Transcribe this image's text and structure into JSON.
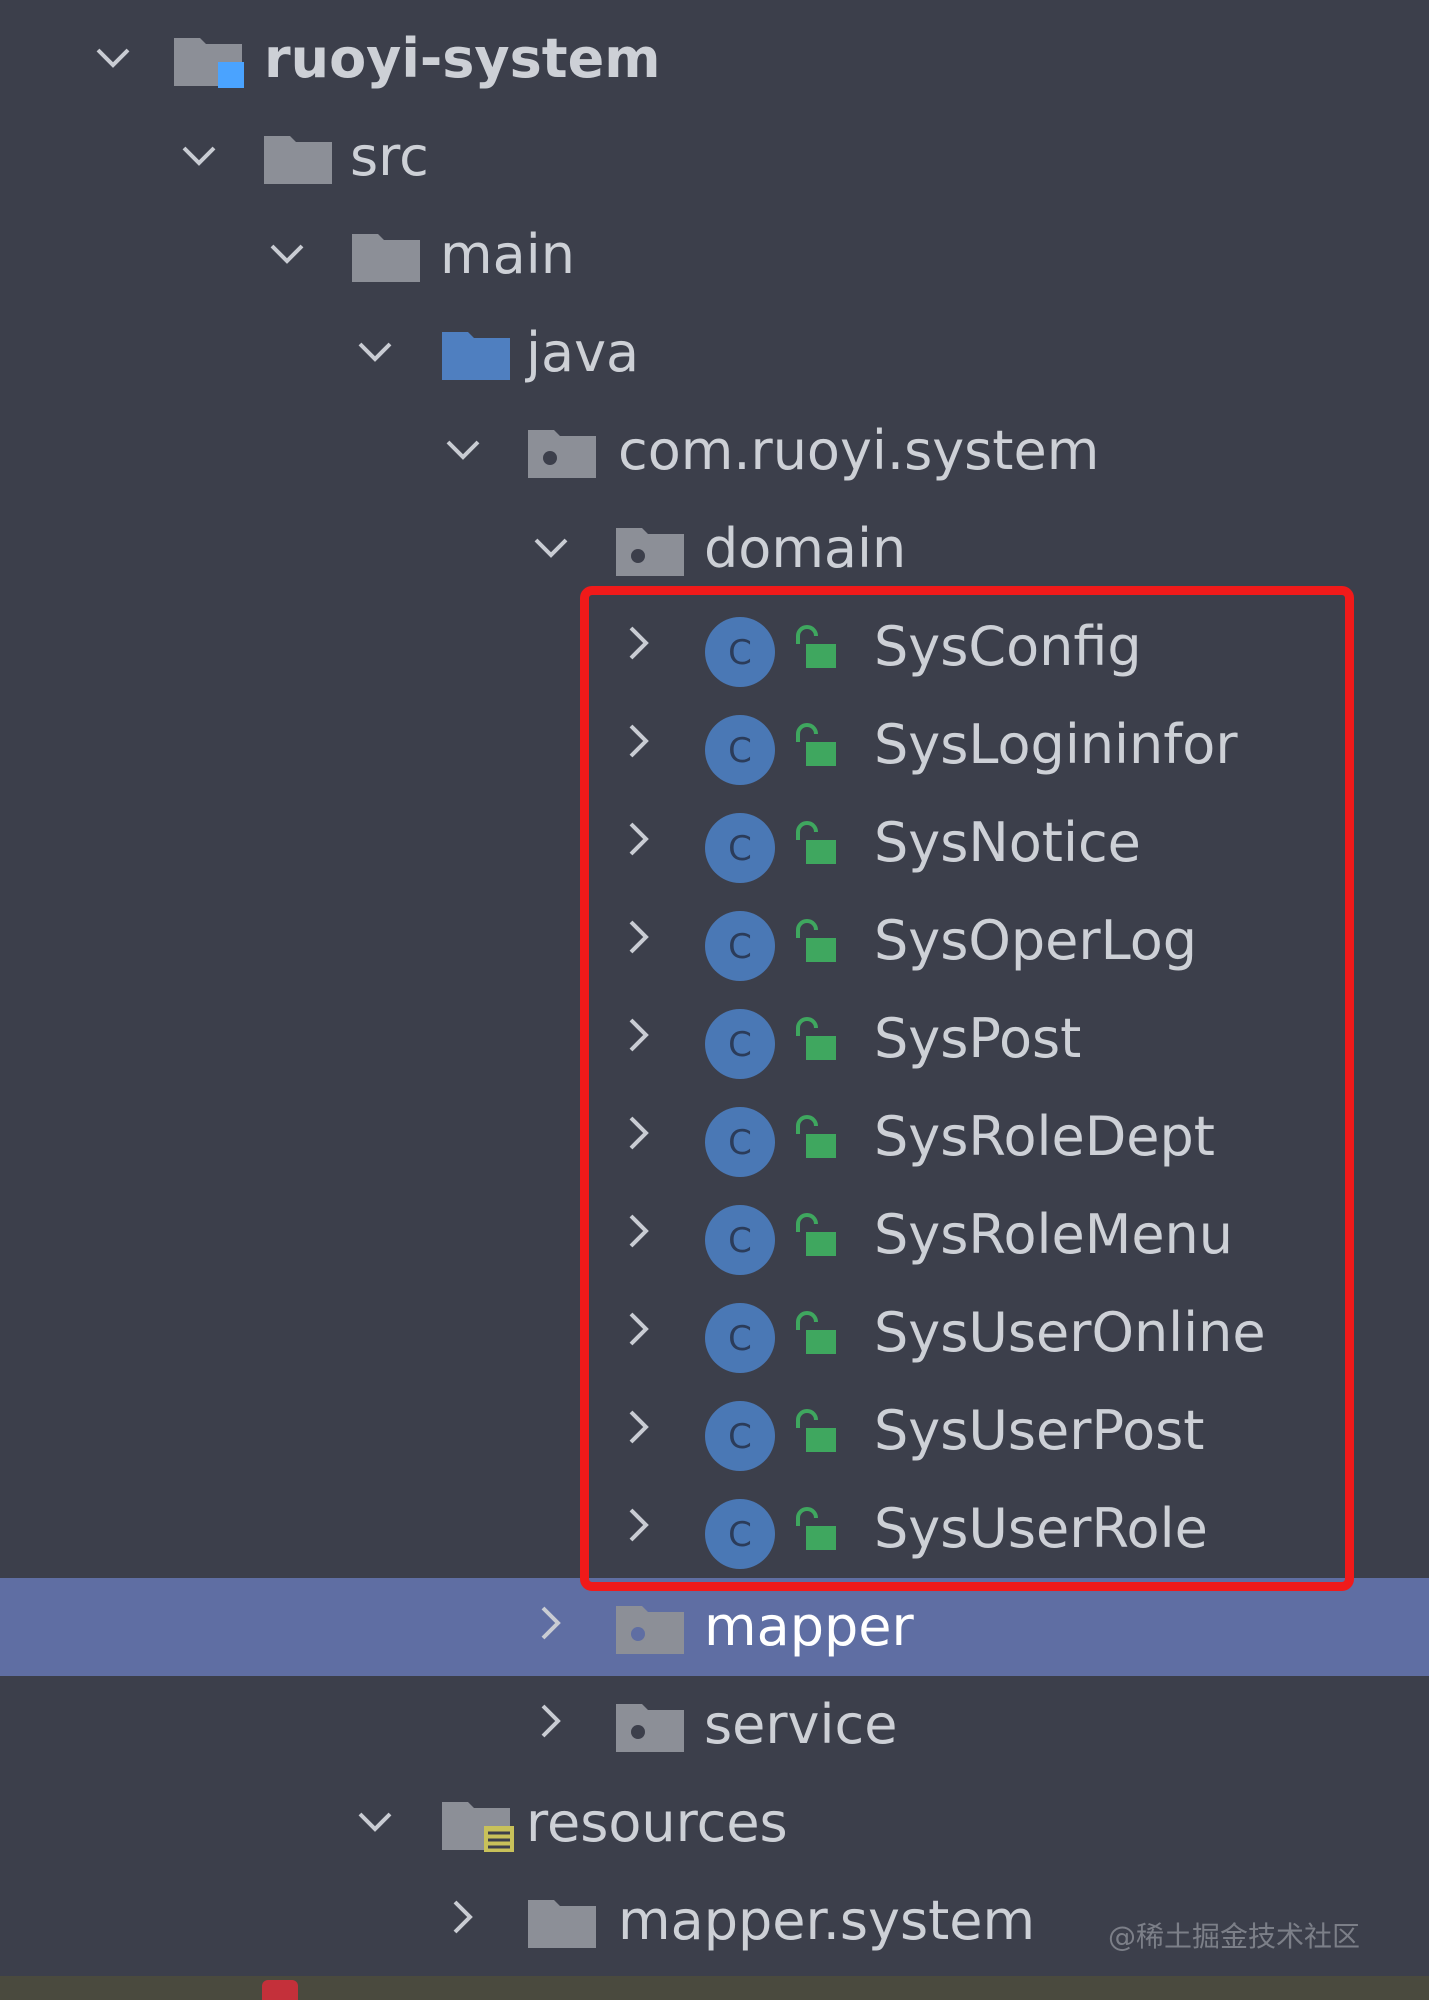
{
  "tree": {
    "items": [
      {
        "label": "ruoyi-system",
        "expanded": true,
        "icon": "module-folder-icon",
        "bold": true
      },
      {
        "label": "src",
        "expanded": true,
        "icon": "folder-icon"
      },
      {
        "label": "main",
        "expanded": true,
        "icon": "folder-icon"
      },
      {
        "label": "java",
        "expanded": true,
        "icon": "source-folder-icon"
      },
      {
        "label": "com.ruoyi.system",
        "expanded": true,
        "icon": "package-icon"
      },
      {
        "label": "domain",
        "expanded": true,
        "icon": "package-icon"
      },
      {
        "label": "SysConfig",
        "expanded": false,
        "icon": "class-icon"
      },
      {
        "label": "SysLogininfor",
        "expanded": false,
        "icon": "class-icon"
      },
      {
        "label": "SysNotice",
        "expanded": false,
        "icon": "class-icon"
      },
      {
        "label": "SysOperLog",
        "expanded": false,
        "icon": "class-icon"
      },
      {
        "label": "SysPost",
        "expanded": false,
        "icon": "class-icon"
      },
      {
        "label": "SysRoleDept",
        "expanded": false,
        "icon": "class-icon"
      },
      {
        "label": "SysRoleMenu",
        "expanded": false,
        "icon": "class-icon"
      },
      {
        "label": "SysUserOnline",
        "expanded": false,
        "icon": "class-icon"
      },
      {
        "label": "SysUserPost",
        "expanded": false,
        "icon": "class-icon"
      },
      {
        "label": "SysUserRole",
        "expanded": false,
        "icon": "class-icon"
      },
      {
        "label": "mapper",
        "expanded": false,
        "icon": "package-icon",
        "selected": true
      },
      {
        "label": "service",
        "expanded": false,
        "icon": "package-icon"
      },
      {
        "label": "resources",
        "expanded": true,
        "icon": "resources-folder-icon"
      },
      {
        "label": "mapper.system",
        "expanded": false,
        "icon": "folder-icon"
      }
    ],
    "class_letter": "C"
  },
  "watermark": "@稀土掘金技术社区",
  "colors": {
    "background": "#3c3f4b",
    "selection": "#5f6ea3",
    "highlight_border": "#f01a1a",
    "class_icon": "#4a78b5",
    "lock_icon": "#3fa75f",
    "folder": "#8c8f97",
    "source_folder": "#4f7fc0"
  }
}
